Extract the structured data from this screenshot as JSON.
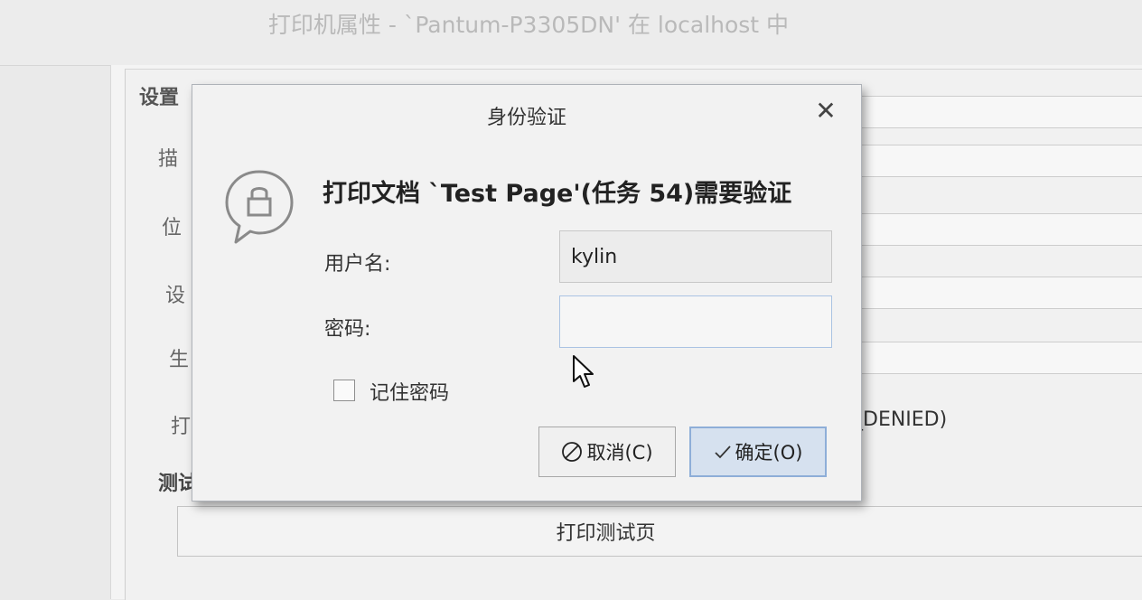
{
  "window": {
    "title": "打印机属性 - `Pantum-P3305DN' 在 localhost 中"
  },
  "settings": {
    "group_title": "设置",
    "labels": [
      "描",
      "位",
      "设",
      "生",
      "打"
    ],
    "state_value_fragment": "_DENIED)",
    "test_group_title": "测试",
    "print_test_page_label": "打印测试页"
  },
  "dialog": {
    "title": "身份验证",
    "message": "打印文档 `Test Page'(任务 54)需要验证",
    "username_label": "用户名:",
    "username_value": "kylin",
    "password_label": "密码:",
    "password_value": "",
    "remember_label": "记住密码",
    "remember_checked": false,
    "cancel_label": "取消(C)",
    "ok_label": "确定(O)",
    "close_glyph": "✕"
  },
  "icons": {
    "close": "close-icon",
    "lock": "lock-chat-icon",
    "cancel": "cancel-circle-icon",
    "ok": "check-icon",
    "cursor": "mouse-pointer-icon"
  }
}
